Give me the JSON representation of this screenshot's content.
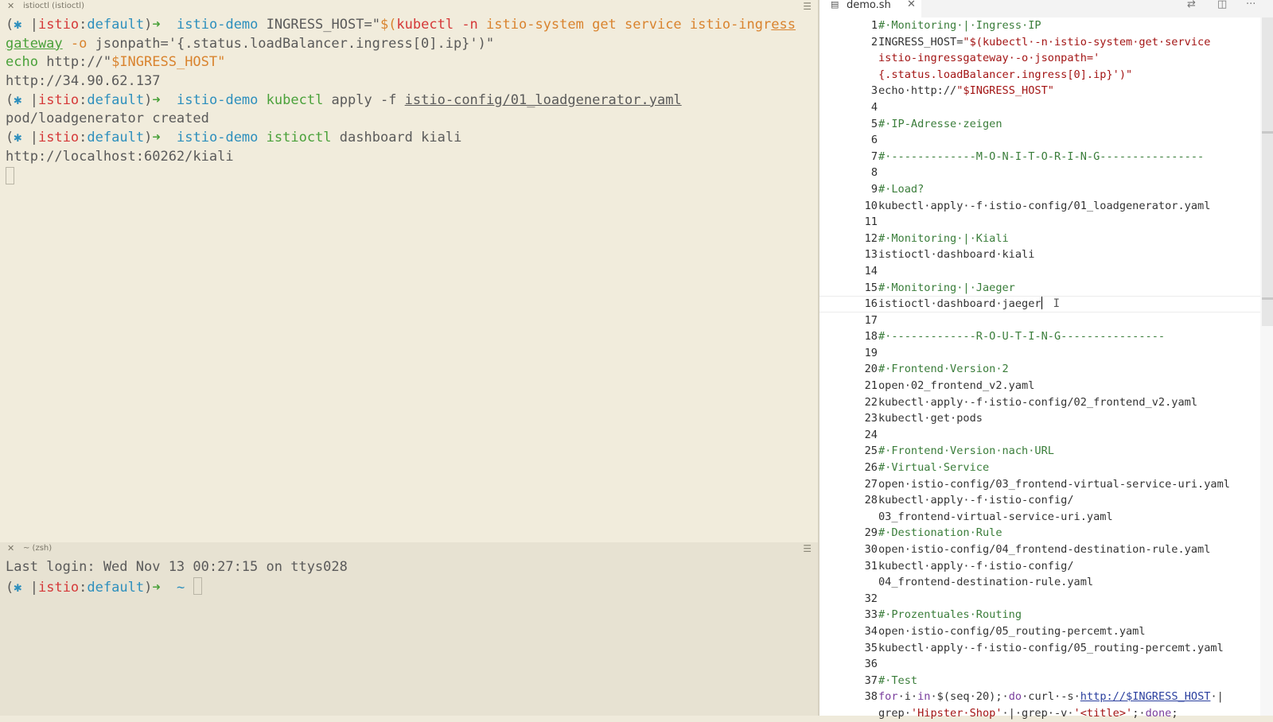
{
  "terminal_top": {
    "title": "istioctl (istioctl)",
    "close_icon": "close-icon",
    "menu_icon": "hamburger-icon",
    "lines": [
      [
        {
          "t": "(",
          "c": "c-gray"
        },
        {
          "t": "✱",
          "c": "c-blue"
        },
        {
          "t": " |",
          "c": "c-gray"
        },
        {
          "t": "istio",
          "c": "c-red"
        },
        {
          "t": ":",
          "c": "c-gray"
        },
        {
          "t": "default",
          "c": "c-blue"
        },
        {
          "t": ")",
          "c": "c-gray"
        },
        {
          "t": "➜  ",
          "c": "c-green"
        },
        {
          "t": "istio-demo",
          "c": "c-blue"
        },
        {
          "t": " INGRESS_HOST=\"",
          "c": "c-gray"
        },
        {
          "t": "$(",
          "c": "c-orange"
        },
        {
          "t": "kubectl",
          "c": "c-red"
        },
        {
          "t": " -n ",
          "c": "c-red"
        },
        {
          "t": "istio-system get service istio-ingr",
          "c": "c-orange"
        },
        {
          "t": "ess",
          "c": "c-orange ul"
        }
      ],
      [
        {
          "t": "gateway",
          "c": "c-green ul"
        },
        {
          "t": " -o ",
          "c": "c-orange"
        },
        {
          "t": "jsonpath='{.status.loadBalancer.ingress[0].ip}'",
          "c": "c-gray"
        },
        {
          "t": ")\"",
          "c": "c-gray"
        }
      ],
      [
        {
          "t": "echo",
          "c": "c-green"
        },
        {
          "t": " http://\"",
          "c": "c-gray"
        },
        {
          "t": "$INGRESS_HOST",
          "c": "c-orange"
        },
        {
          "t": "\"",
          "c": "c-orange"
        }
      ],
      [
        {
          "t": "http://34.90.62.137",
          "c": "c-gray"
        }
      ],
      [
        {
          "t": "(",
          "c": "c-gray"
        },
        {
          "t": "✱",
          "c": "c-blue"
        },
        {
          "t": " |",
          "c": "c-gray"
        },
        {
          "t": "istio",
          "c": "c-red"
        },
        {
          "t": ":",
          "c": "c-gray"
        },
        {
          "t": "default",
          "c": "c-blue"
        },
        {
          "t": ")",
          "c": "c-gray"
        },
        {
          "t": "➜  ",
          "c": "c-green"
        },
        {
          "t": "istio-demo",
          "c": "c-blue"
        },
        {
          "t": " ",
          "c": "c-gray"
        },
        {
          "t": "kubectl",
          "c": "c-green"
        },
        {
          "t": " apply -f ",
          "c": "c-gray"
        },
        {
          "t": "istio-config/01_loadgenerator.yaml",
          "c": "c-gray ul"
        }
      ],
      [
        {
          "t": "pod/loadgenerator created",
          "c": "c-gray"
        }
      ],
      [
        {
          "t": "(",
          "c": "c-gray"
        },
        {
          "t": "✱",
          "c": "c-blue"
        },
        {
          "t": " |",
          "c": "c-gray"
        },
        {
          "t": "istio",
          "c": "c-red"
        },
        {
          "t": ":",
          "c": "c-gray"
        },
        {
          "t": "default",
          "c": "c-blue"
        },
        {
          "t": ")",
          "c": "c-gray"
        },
        {
          "t": "➜  ",
          "c": "c-green"
        },
        {
          "t": "istio-demo",
          "c": "c-blue"
        },
        {
          "t": " ",
          "c": "c-gray"
        },
        {
          "t": "istioctl",
          "c": "c-green"
        },
        {
          "t": " dashboard kiali",
          "c": "c-gray"
        }
      ],
      [
        {
          "t": "http://localhost:60262/kiali",
          "c": "c-gray"
        }
      ]
    ]
  },
  "terminal_bottom": {
    "title": "~ (zsh)",
    "close_icon": "close-icon",
    "menu_icon": "hamburger-icon",
    "lines": [
      [
        {
          "t": "Last login: Wed Nov 13 00:27:15 on ttys028",
          "c": "c-gray"
        }
      ],
      [
        {
          "t": "(",
          "c": "c-gray"
        },
        {
          "t": "✱",
          "c": "c-blue"
        },
        {
          "t": " |",
          "c": "c-gray"
        },
        {
          "t": "istio",
          "c": "c-red"
        },
        {
          "t": ":",
          "c": "c-gray"
        },
        {
          "t": "default",
          "c": "c-blue"
        },
        {
          "t": ")",
          "c": "c-gray"
        },
        {
          "t": "➜  ",
          "c": "c-green"
        },
        {
          "t": "~",
          "c": "c-blue"
        },
        {
          "t": " ",
          "c": "c-gray"
        }
      ]
    ]
  },
  "editor": {
    "tab_label": "demo.sh",
    "tab_icon": "file-icon",
    "tab_close_icon": "close-icon",
    "toolbar_icons": [
      "compare-changes-icon",
      "split-editor-icon",
      "more-actions-icon"
    ],
    "current_line": 16,
    "lines": [
      {
        "n": "1",
        "s": [
          {
            "t": "#·Monitoring·|·Ingress·IP",
            "c": "cm"
          }
        ]
      },
      {
        "n": "2",
        "s": [
          {
            "t": "INGRESS_HOST=",
            "c": ""
          },
          {
            "t": "\"$(kubectl·-n·istio-system·get·service",
            "c": "str"
          }
        ]
      },
      {
        "n": "",
        "s": [
          {
            "t": "istio-ingressgateway·-o·jsonpath='",
            "c": "str"
          }
        ]
      },
      {
        "n": "",
        "s": [
          {
            "t": "{.status.loadBalancer.ingress[0].ip}')\"",
            "c": "str"
          }
        ]
      },
      {
        "n": "3",
        "s": [
          {
            "t": "echo·http://",
            "c": ""
          },
          {
            "t": "\"$INGRESS_HOST\"",
            "c": "str"
          }
        ]
      },
      {
        "n": "4",
        "s": []
      },
      {
        "n": "5",
        "s": [
          {
            "t": "#·IP-Adresse·zeigen",
            "c": "cm"
          }
        ]
      },
      {
        "n": "6",
        "s": []
      },
      {
        "n": "7",
        "s": [
          {
            "t": "#·-------------M-O-N-I-T-O-R-I-N-G----------------",
            "c": "cm"
          }
        ]
      },
      {
        "n": "8",
        "s": []
      },
      {
        "n": "9",
        "s": [
          {
            "t": "#·Load?",
            "c": "cm"
          }
        ]
      },
      {
        "n": "10",
        "s": [
          {
            "t": "kubectl·apply·-f·istio-config/01_loadgenerator.yaml",
            "c": ""
          }
        ]
      },
      {
        "n": "11",
        "s": []
      },
      {
        "n": "12",
        "s": [
          {
            "t": "#·Monitoring·|·Kiali",
            "c": "cm"
          }
        ]
      },
      {
        "n": "13",
        "s": [
          {
            "t": "istioctl·dashboard·kiali",
            "c": ""
          }
        ]
      },
      {
        "n": "14",
        "s": []
      },
      {
        "n": "15",
        "s": [
          {
            "t": "#·Monitoring·|·Jaeger",
            "c": "cm"
          }
        ]
      },
      {
        "n": "16",
        "s": [
          {
            "t": "istioctl·dashboard·jaeger",
            "c": ""
          }
        ]
      },
      {
        "n": "17",
        "s": []
      },
      {
        "n": "18",
        "s": [
          {
            "t": "#·-------------R-O-U-T-I-N-G----------------",
            "c": "cm"
          }
        ]
      },
      {
        "n": "19",
        "s": []
      },
      {
        "n": "20",
        "s": [
          {
            "t": "#·Frontend·Version·2",
            "c": "cm"
          }
        ]
      },
      {
        "n": "21",
        "s": [
          {
            "t": "open·02_frontend_v2.yaml",
            "c": ""
          }
        ]
      },
      {
        "n": "22",
        "s": [
          {
            "t": "kubectl·apply·-f·istio-config/02_frontend_v2.yaml",
            "c": ""
          }
        ]
      },
      {
        "n": "23",
        "s": [
          {
            "t": "kubectl·get·pods",
            "c": ""
          }
        ]
      },
      {
        "n": "24",
        "s": []
      },
      {
        "n": "25",
        "s": [
          {
            "t": "#·Frontend·Version·nach·URL",
            "c": "cm"
          }
        ]
      },
      {
        "n": "26",
        "s": [
          {
            "t": "#·Virtual·Service",
            "c": "cm"
          }
        ]
      },
      {
        "n": "27",
        "s": [
          {
            "t": "open·istio-config/03_frontend-virtual-service-uri.yaml",
            "c": ""
          }
        ]
      },
      {
        "n": "28",
        "s": [
          {
            "t": "kubectl·apply·-f·istio-config/",
            "c": ""
          }
        ]
      },
      {
        "n": "",
        "s": [
          {
            "t": "03_frontend-virtual-service-uri.yaml",
            "c": ""
          }
        ]
      },
      {
        "n": "29",
        "s": [
          {
            "t": "#·Destionation·Rule",
            "c": "cm"
          }
        ]
      },
      {
        "n": "30",
        "s": [
          {
            "t": "open·istio-config/04_frontend-destination-rule.yaml",
            "c": ""
          }
        ]
      },
      {
        "n": "31",
        "s": [
          {
            "t": "kubectl·apply·-f·istio-config/",
            "c": ""
          }
        ]
      },
      {
        "n": "",
        "s": [
          {
            "t": "04_frontend-destination-rule.yaml",
            "c": ""
          }
        ]
      },
      {
        "n": "32",
        "s": []
      },
      {
        "n": "33",
        "s": [
          {
            "t": "#·Prozentuales·Routing",
            "c": "cm"
          }
        ]
      },
      {
        "n": "34",
        "s": [
          {
            "t": "open·istio-config/05_routing-percemt.yaml",
            "c": ""
          }
        ]
      },
      {
        "n": "35",
        "s": [
          {
            "t": "kubectl·apply·-f·istio-config/05_routing-percemt.yaml",
            "c": ""
          }
        ]
      },
      {
        "n": "36",
        "s": []
      },
      {
        "n": "37",
        "s": [
          {
            "t": "#·Test",
            "c": "cm"
          }
        ]
      },
      {
        "n": "38",
        "s": [
          {
            "t": "for",
            "c": "kw"
          },
          {
            "t": "·i·",
            "c": ""
          },
          {
            "t": "in",
            "c": "kw"
          },
          {
            "t": "·$(seq·20);·",
            "c": ""
          },
          {
            "t": "do",
            "c": "kw"
          },
          {
            "t": "·curl·-s·",
            "c": ""
          },
          {
            "t": "http://$INGRESS_HOST",
            "c": "link"
          },
          {
            "t": "·|",
            "c": ""
          }
        ]
      },
      {
        "n": "",
        "s": [
          {
            "t": "grep·",
            "c": ""
          },
          {
            "t": "'Hipster·Shop'",
            "c": "str"
          },
          {
            "t": "·|·grep·-v·",
            "c": ""
          },
          {
            "t": "'<title>'",
            "c": "str"
          },
          {
            "t": ";·",
            "c": ""
          },
          {
            "t": "done",
            "c": "kw"
          },
          {
            "t": ";",
            "c": ""
          }
        ]
      }
    ]
  }
}
